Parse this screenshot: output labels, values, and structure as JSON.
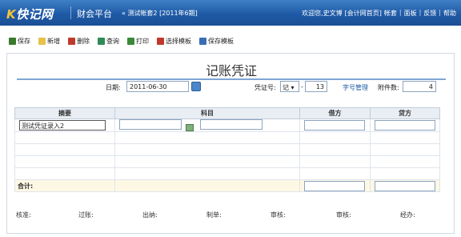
{
  "header": {
    "logo": "快记网",
    "platform": "财会平台",
    "book": "« 测试帐套2  [2011年6期]",
    "right": [
      "欢迎您,史文博",
      "[会计网首页]",
      "帐套",
      "面板",
      "反馈",
      "帮助"
    ]
  },
  "toolbar": {
    "buttons": [
      {
        "label": "保存",
        "icon": "save-icon",
        "color": "#3a7a2a"
      },
      {
        "label": "新增",
        "icon": "new-icon",
        "color": "#d4a017"
      },
      {
        "label": "删除",
        "icon": "delete-icon",
        "color": "#c0392b"
      },
      {
        "label": "查询",
        "icon": "search-icon",
        "color": "#2e8b57"
      },
      {
        "label": "打印",
        "icon": "print-icon",
        "color": "#3a8a3a"
      },
      {
        "label": "选择模板",
        "icon": "template-icon",
        "color": "#c0392b"
      },
      {
        "label": "保存模板",
        "icon": "save-template-icon",
        "color": "#3a6db5"
      }
    ]
  },
  "voucher": {
    "title": "记账凭证",
    "date_label": "日期:",
    "date_value": "2011-06-30",
    "voucher_no_label": "凭证号:",
    "voucher_type": "记",
    "voucher_no": "13",
    "manage_link": "字号管理",
    "attachments_label": "附件数:",
    "attachments": "4"
  },
  "table": {
    "headers": [
      "摘要",
      "科目",
      "借方",
      "贷方"
    ],
    "first_summary": "测试凭证录入2",
    "total_label": "合计:"
  },
  "signatures": [
    "核准:",
    "过账:",
    "出纳:",
    "制单:",
    "审核:",
    "审核:",
    "经办:"
  ]
}
